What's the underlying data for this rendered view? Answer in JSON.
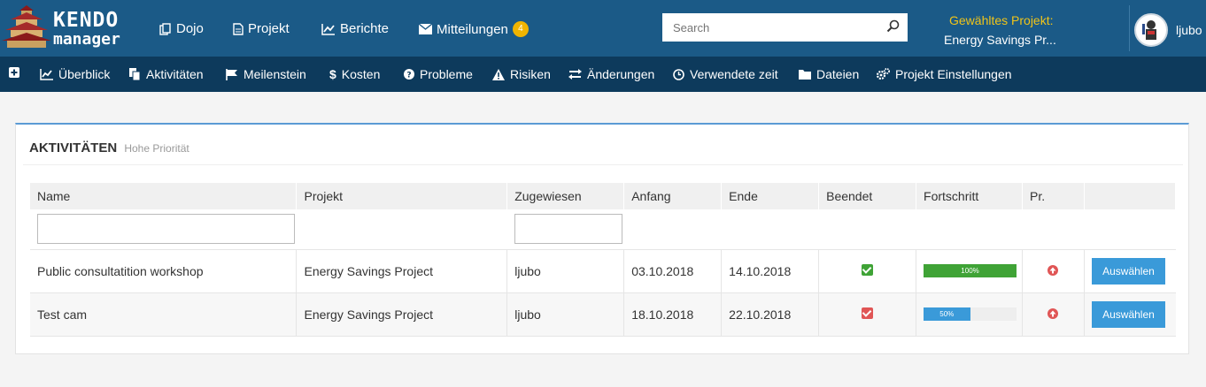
{
  "brand": {
    "line1": "KENDO",
    "line2": "manager"
  },
  "topnav": [
    {
      "label": "Dojo",
      "icon": "copy-icon"
    },
    {
      "label": "Projekt",
      "icon": "file-icon"
    },
    {
      "label": "Berichte",
      "icon": "line-chart-icon"
    },
    {
      "label": "Mitteilungen",
      "icon": "envelope-icon",
      "badge": "4"
    }
  ],
  "search": {
    "placeholder": "Search"
  },
  "project": {
    "label": "Gewähltes Projekt:",
    "name": "Energy Savings Pr..."
  },
  "user": {
    "name": "ljubo"
  },
  "subnav": [
    {
      "label": "",
      "icon": "plus-square-icon"
    },
    {
      "label": "Überblick",
      "icon": "area-chart-icon"
    },
    {
      "label": "Aktivitäten",
      "icon": "files-icon"
    },
    {
      "label": "Meilenstein",
      "icon": "flag-icon"
    },
    {
      "label": "Kosten",
      "icon": "dollar-icon"
    },
    {
      "label": "Probleme",
      "icon": "question-circle-icon"
    },
    {
      "label": "Risiken",
      "icon": "warning-icon"
    },
    {
      "label": "Änderungen",
      "icon": "exchange-icon"
    },
    {
      "label": "Verwendete zeit",
      "icon": "clock-icon"
    },
    {
      "label": "Dateien",
      "icon": "folder-icon"
    },
    {
      "label": "Projekt Einstellungen",
      "icon": "cogs-icon"
    }
  ],
  "panel": {
    "title": "AKTIVITÄTEN",
    "subtitle": "Hohe Priorität"
  },
  "table": {
    "headers": [
      "Name",
      "Projekt",
      "Zugewiesen",
      "Anfang",
      "Ende",
      "Beendet",
      "Fortschritt",
      "Pr.",
      ""
    ],
    "rows": [
      {
        "name": "Public consultatition workshop",
        "project": "Energy Savings Project",
        "assigned": "ljubo",
        "start": "03.10.2018",
        "end": "14.10.2018",
        "done": true,
        "progress": 100,
        "progress_label": "100%",
        "action": "Auswählen"
      },
      {
        "name": "Test cam",
        "project": "Energy Savings Project",
        "assigned": "ljubo",
        "start": "18.10.2018",
        "end": "22.10.2018",
        "done": false,
        "progress": 50,
        "progress_label": "50%",
        "action": "Auswählen"
      }
    ]
  },
  "colors": {
    "topbar": "#1b5a87",
    "subnav": "#0d3a5c",
    "accent": "#3a9ad9",
    "done": "#3fa336",
    "notdone": "#e05555",
    "progress_full": "#3fa336",
    "progress_partial": "#3a9ad9"
  }
}
